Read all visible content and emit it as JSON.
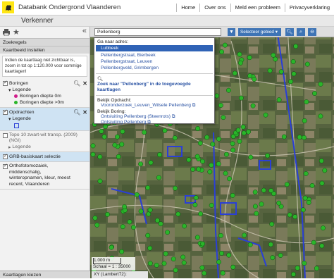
{
  "header": {
    "app_title": "Databank Ondergrond Vlaanderen",
    "nav": [
      "Home",
      "Over ons",
      "Meld een probleem",
      "Privacyverklaring"
    ]
  },
  "titlebar": {
    "title": "Verkenner",
    "collapse": "«"
  },
  "sidebar": {
    "section_search": "Zoekregels",
    "section_map": "Kaartbeeld instellen",
    "info_text": "Indien de kaartlaag niet zichtbaar is, zoom in tot op 1:120.000 voor sommige kaartlagen!",
    "layers": {
      "boringen": {
        "label": "Boringen",
        "legend": "Legende",
        "items": [
          "Boringen diepte 0m",
          "Boringen diepte >0m"
        ]
      },
      "opdrachten": {
        "label": "Opdrachten",
        "legend": "Legende"
      },
      "topo": {
        "label": "Topo 10 zwart-wit transp. (2009) (NGI)",
        "legend": "Legende"
      },
      "grb": {
        "label": "GRB-basiskaart selectie"
      },
      "ortho": {
        "label": "Orthofotomozaiek, middenschalig, winteropnamen, kleur, meest recent, Vlaanderen"
      }
    },
    "bottom": "Kaartlagen kiezen"
  },
  "toolbar": {
    "search_value": "Pellenberg",
    "select_area": "Selecteer gebied ▾"
  },
  "dropdown": {
    "heading": "Ga naar adres:",
    "addresses": [
      "Lubbeek",
      "Pellenbergstraat, Bierbeek",
      "Pellenbergstraat, Leuven",
      "Pellenbergveld, Grimbergen"
    ],
    "zoom_link": "Zoek naar \"Pellenberg\" in de toegevoegde kaartlagen",
    "opdracht_heading": "Bekijk Opdracht:",
    "opdracht_link": "Vooronderzoek_Leuven_Wilsele Pellenberg",
    "boring_heading": "Bekijk Boring:",
    "boring_links": [
      "Ontsluiting Pellenberg (Steenrots)",
      "Ontsluiting Pellenberg"
    ]
  },
  "map": {
    "scale_bar": "1.000 m",
    "scale": "Schaal = 1 : 35000",
    "coords": "XY (Lambert72):"
  },
  "colors": {
    "boring_shallow": "#d01c8b",
    "boring_deep": "#2ab52a",
    "accent": "#3e74b5",
    "parcel_outline": "#2a3fd6"
  }
}
